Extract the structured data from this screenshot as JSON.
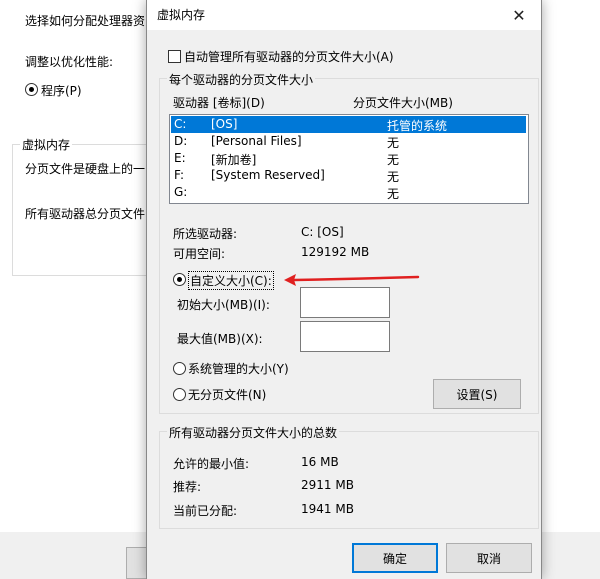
{
  "background_dialog": {
    "text_select_processor": "选择如何分配处理器资",
    "text_adjust_for": "调整以优化性能:",
    "radio_programs": "程序(P)",
    "group_virtual_memory": "虚拟内存",
    "text_paging_file_is": "分页文件是硬盘上的一",
    "text_total_paging": "所有驱动器总分页文件"
  },
  "dialog": {
    "title": "虚拟内存",
    "close_glyph": "✕",
    "auto_manage_label": "自动管理所有驱动器的分页文件大小(A)",
    "auto_manage_checked": false,
    "per_drive_group": "每个驱动器的分页文件大小",
    "col_drive": "驱动器 [卷标](D)",
    "col_size": "分页文件大小(MB)",
    "drives": [
      {
        "drive": "C:",
        "label": "[OS]",
        "size": "托管的系统",
        "selected": true
      },
      {
        "drive": "D:",
        "label": "[Personal Files]",
        "size": "无",
        "selected": false
      },
      {
        "drive": "E:",
        "label": "[新加卷]",
        "size": "无",
        "selected": false
      },
      {
        "drive": "F:",
        "label": "[System Reserved]",
        "size": "无",
        "selected": false
      },
      {
        "drive": "G:",
        "label": "",
        "size": "无",
        "selected": false
      }
    ],
    "selected_drive_label": "所选驱动器:",
    "selected_drive_value": "C:  [OS]",
    "free_space_label": "可用空间:",
    "free_space_value": "129192 MB",
    "custom_size_label": "自定义大小(C):",
    "initial_size_label": "初始大小(MB)(I):",
    "initial_size_value": "",
    "max_size_label": "最大值(MB)(X):",
    "max_size_value": "",
    "system_managed_label": "系统管理的大小(Y)",
    "no_paging_label": "无分页文件(N)",
    "set_button": "设置(S)",
    "totals_group": "所有驱动器分页文件大小的总数",
    "min_allowed_label": "允许的最小值:",
    "min_allowed_value": "16 MB",
    "recommended_label": "推荐:",
    "recommended_value": "2911 MB",
    "allocated_label": "当前已分配:",
    "allocated_value": "1941 MB",
    "ok_button": "确定",
    "cancel_button": "取消"
  },
  "colors": {
    "selection": "#0078d7",
    "annotation_arrow": "#e02020"
  }
}
